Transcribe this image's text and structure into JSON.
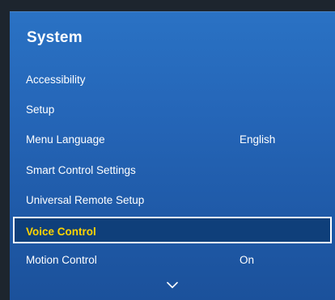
{
  "panel": {
    "title": "System"
  },
  "menu": {
    "items": [
      {
        "label": "Accessibility",
        "value": ""
      },
      {
        "label": "Setup",
        "value": ""
      },
      {
        "label": "Menu Language",
        "value": "English"
      },
      {
        "label": "Smart Control Settings",
        "value": ""
      },
      {
        "label": "Universal Remote Setup",
        "value": ""
      },
      {
        "label": "Voice Control",
        "value": "",
        "selected": true
      },
      {
        "label": "Motion Control",
        "value": "On"
      }
    ]
  },
  "icons": {
    "scroll_down": "chevron-down-icon"
  },
  "colors": {
    "panel_top": "#2a72c4",
    "panel_bottom": "#1b519b",
    "selected_bg": "#0f3f7a",
    "selected_text": "#ffd400",
    "text": "#ffffff"
  }
}
